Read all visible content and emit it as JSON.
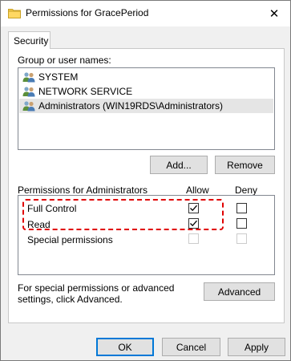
{
  "window": {
    "title": "Permissions for GracePeriod",
    "close_glyph": "✕"
  },
  "tabs": [
    {
      "label": "Security"
    }
  ],
  "group_section": {
    "label": "Group or user names:",
    "users": [
      {
        "name": "SYSTEM",
        "selected": false
      },
      {
        "name": "NETWORK SERVICE",
        "selected": false
      },
      {
        "name": "Administrators (WIN19RDS\\Administrators)",
        "selected": true
      }
    ],
    "add_button": "Add...",
    "remove_button": "Remove"
  },
  "permissions": {
    "header": "Permissions for Administrators",
    "allow_header": "Allow",
    "deny_header": "Deny",
    "rows": [
      {
        "name": "Full Control",
        "allow": true,
        "deny": false,
        "enabled": true
      },
      {
        "name": "Read",
        "allow": true,
        "deny": false,
        "enabled": true
      },
      {
        "name": "Special permissions",
        "allow": false,
        "deny": false,
        "enabled": false
      }
    ]
  },
  "advanced": {
    "text": "For special permissions or advanced settings, click Advanced.",
    "button": "Advanced"
  },
  "footer": {
    "ok": "OK",
    "cancel": "Cancel",
    "apply": "Apply"
  },
  "colors": {
    "highlight_dash": "#e00000",
    "selection": "#e5e5e5",
    "default_button_border": "#0078d7"
  },
  "icons": {
    "title": "folder-icon",
    "user": "users-group-icon",
    "check": "checkmark-icon"
  }
}
